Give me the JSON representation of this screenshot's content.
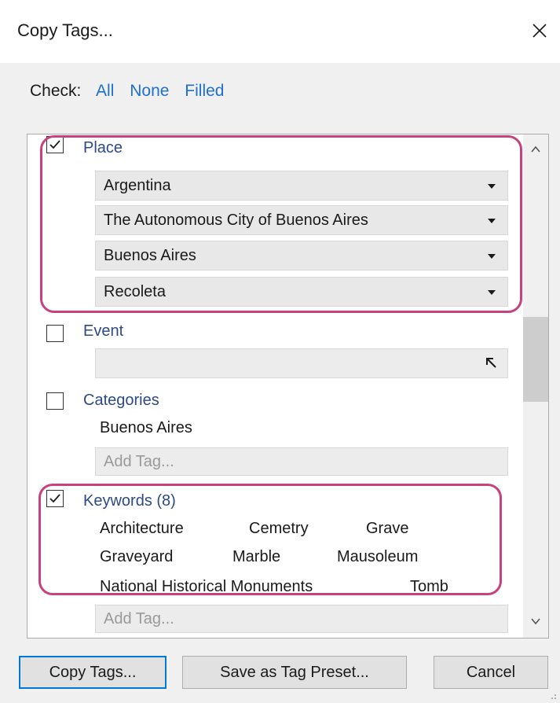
{
  "window": {
    "title": "Copy Tags...",
    "close_icon": "close-icon"
  },
  "check": {
    "label": "Check:",
    "all": "All",
    "none": "None",
    "filled": "Filled"
  },
  "sections": {
    "place": {
      "label": "Place",
      "checked": true,
      "values": [
        "Argentina",
        "The Autonomous City of Buenos Aires",
        "Buenos Aires",
        "Recoleta"
      ]
    },
    "event": {
      "label": "Event",
      "checked": false,
      "value": "",
      "picker_icon": "arrow-up-left-icon"
    },
    "categories": {
      "label": "Categories",
      "checked": false,
      "items": [
        "Buenos Aires"
      ],
      "add_placeholder": "Add Tag..."
    },
    "keywords": {
      "label": "Keywords (8)",
      "checked": true,
      "items": [
        "Architecture",
        "Cemetry",
        "Grave",
        "Graveyard",
        "Marble",
        "Mausoleum",
        "National Historical Monuments",
        "Tomb"
      ],
      "add_placeholder": "Add Tag..."
    }
  },
  "buttons": {
    "copy": "Copy Tags...",
    "save_preset": "Save as Tag Preset...",
    "cancel": "Cancel"
  },
  "colors": {
    "highlight": "#c8417f",
    "link": "#1f6fd1",
    "section_label": "#2d4a87",
    "primary_border": "#0078d7"
  }
}
